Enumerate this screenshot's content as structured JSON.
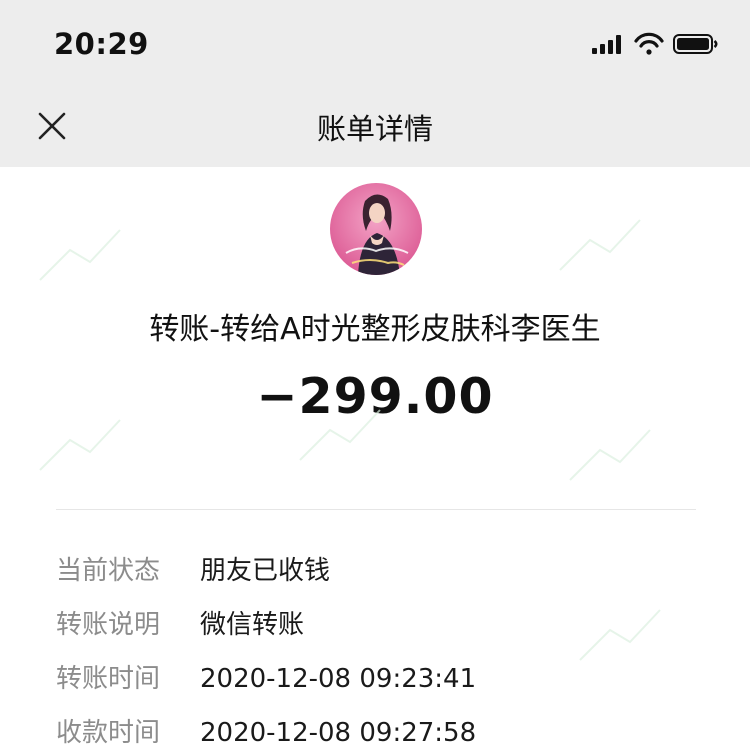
{
  "status_bar": {
    "time": "20:29"
  },
  "nav": {
    "title": "账单详情",
    "close_icon": "close-icon"
  },
  "transaction": {
    "payee": "转账-转给A时光整形皮肤科李医生",
    "amount": "−299.00"
  },
  "details": [
    {
      "label": "当前状态",
      "value": "朋友已收钱"
    },
    {
      "label": "转账说明",
      "value": "微信转账"
    },
    {
      "label": "转账时间",
      "value": "2020-12-08 09:23:41"
    },
    {
      "label": "收款时间",
      "value": "2020-12-08 09:27:58"
    }
  ],
  "colors": {
    "header_bg": "#ededed",
    "page_bg": "#ffffff",
    "label_gray": "#8c8c8c",
    "avatar_pink": "#e46aa1"
  }
}
